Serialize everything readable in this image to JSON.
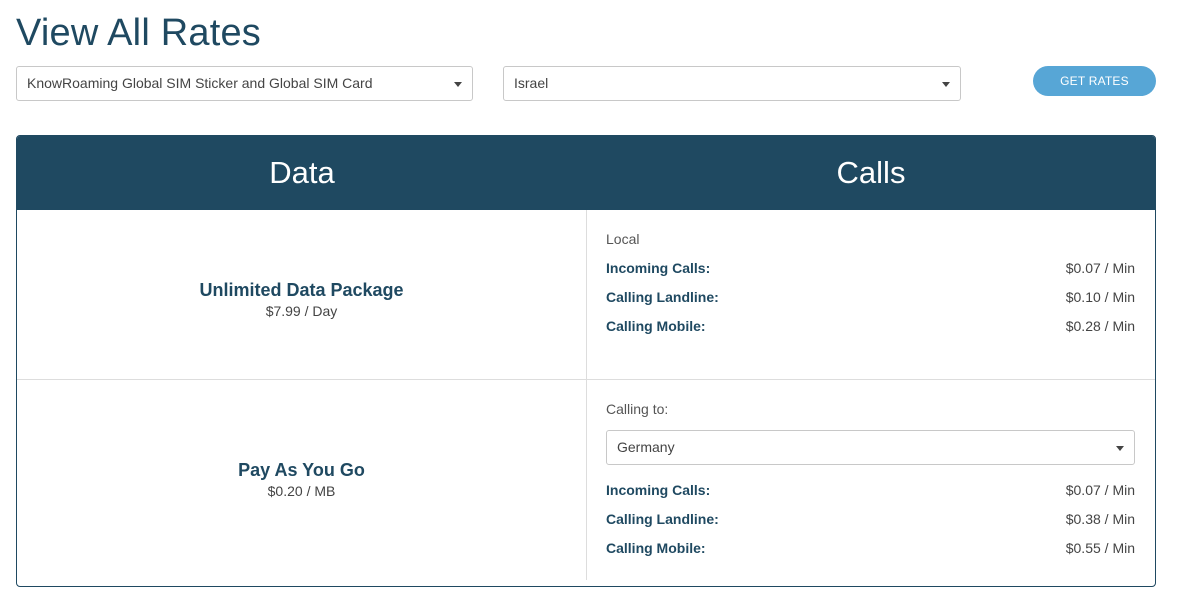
{
  "page": {
    "title": "View All Rates"
  },
  "filters": {
    "product": "KnowRoaming Global SIM Sticker and Global SIM Card",
    "country": "Israel",
    "button": "GET RATES"
  },
  "table": {
    "data_header": "Data",
    "calls_header": "Calls",
    "packages": [
      {
        "name": "Unlimited Data Package",
        "price": "$7.99 / Day"
      },
      {
        "name": "Pay As You Go",
        "price": "$0.20 / MB"
      }
    ],
    "local": {
      "label": "Local",
      "rows": [
        {
          "label": "Incoming Calls:",
          "value": "$0.07 / Min"
        },
        {
          "label": "Calling Landline:",
          "value": "$0.10 / Min"
        },
        {
          "label": "Calling Mobile:",
          "value": "$0.28 / Min"
        }
      ]
    },
    "calling_to": {
      "label": "Calling to:",
      "destination": "Germany",
      "rows": [
        {
          "label": "Incoming Calls:",
          "value": "$0.07 / Min"
        },
        {
          "label": "Calling Landline:",
          "value": "$0.38 / Min"
        },
        {
          "label": "Calling Mobile:",
          "value": "$0.55 / Min"
        }
      ]
    }
  },
  "colors": {
    "navy": "#1f4961",
    "button_blue": "#57a6d6"
  },
  "icons": [
    "chevron-down-icon"
  ]
}
